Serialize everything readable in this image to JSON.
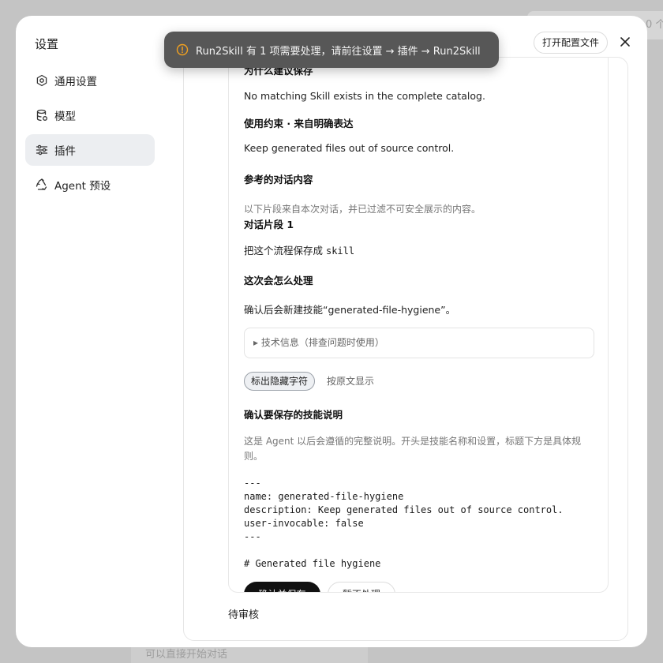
{
  "background": {
    "top_hint": "0 个",
    "bottom_hint": "可以直接开始对话"
  },
  "sidebar": {
    "title": "设置",
    "items": [
      {
        "label": "通用设置",
        "icon": "gear-icon"
      },
      {
        "label": "模型",
        "icon": "database-icon"
      },
      {
        "label": "插件",
        "icon": "sliders-icon",
        "active": true
      },
      {
        "label": "Agent 预设",
        "icon": "recycle-icon"
      }
    ]
  },
  "header": {
    "open_config_label": "打开配置文件",
    "close_icon": "close-icon"
  },
  "toast": {
    "icon": "warning-icon",
    "message": "Run2Skill 有 1 项需要处理，请前往设置 → 插件 → Run2Skill"
  },
  "card": {
    "clipped_heading": "为什么建议保存",
    "reason": "No matching Skill exists in the complete catalog.",
    "constraint_heading": "使用约束 · 来自明确表达",
    "constraint": "Keep generated files out of source control.",
    "reference_heading": "参考的对话内容",
    "reference_note": "以下片段来自本次对话，并已过滤不可安全展示的内容。",
    "fragment_heading": "对话片段 1",
    "fragment_prefix": "把这个流程保存成 ",
    "fragment_code": "skill",
    "handling_heading": "这次会怎么处理",
    "handling": "确认后会新建技能“generated-file-hygiene”。",
    "tech_info": "▸ 技术信息（排查问题时使用）",
    "chip_mark": "标出隐藏字符",
    "chip_raw": "按原文显示",
    "confirm_heading": "确认要保存的技能说明",
    "confirm_desc": "这是 Agent 以后会遵循的完整说明。开头是技能名称和设置，标题下方是具体规则。",
    "code_lines": [
      "---",
      "name: generated-file-hygiene",
      "description: Keep generated files out of source control.",
      "user-invocable: false",
      "---",
      "",
      "# Generated file hygiene"
    ],
    "primary_button": "确认并保存",
    "secondary_button": "暂不处理"
  },
  "status": {
    "pending": "待审核"
  }
}
